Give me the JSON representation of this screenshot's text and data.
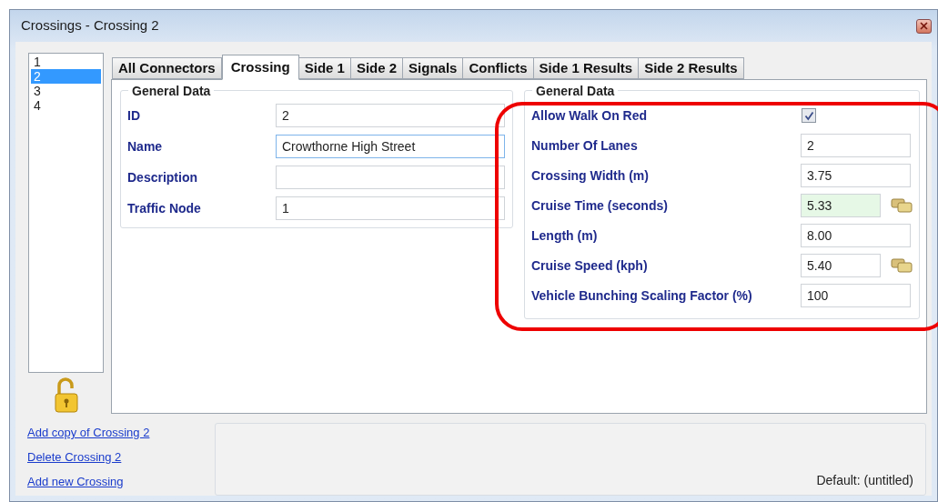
{
  "window": {
    "title": "Crossings - Crossing 2"
  },
  "list": [
    {
      "label": "1",
      "selected": false
    },
    {
      "label": "2",
      "selected": true
    },
    {
      "label": "3",
      "selected": false
    },
    {
      "label": "4",
      "selected": false
    }
  ],
  "tabs": [
    {
      "label": "All Connectors",
      "selected": false
    },
    {
      "label": "Crossing",
      "selected": true
    },
    {
      "label": "Side 1",
      "selected": false
    },
    {
      "label": "Side 2",
      "selected": false
    },
    {
      "label": "Signals",
      "selected": false
    },
    {
      "label": "Conflicts",
      "selected": false
    },
    {
      "label": "Side 1 Results",
      "selected": false
    },
    {
      "label": "Side 2 Results",
      "selected": false
    }
  ],
  "left_group": {
    "title": "General Data",
    "fields": [
      {
        "label": "ID",
        "value": "2",
        "focused": false
      },
      {
        "label": "Name",
        "value": "Crowthorne High Street",
        "focused": true
      },
      {
        "label": "Description",
        "focused": false
      },
      {
        "label": "Traffic Node",
        "value": "1",
        "focused": false
      }
    ]
  },
  "right_group": {
    "title": "General Data",
    "fields": [
      {
        "label": "Allow Walk On Red",
        "kind": "checkbox",
        "checked": true
      },
      {
        "label": "Number Of Lanes",
        "kind": "text",
        "value": "2",
        "tinted": false,
        "calc_button": false
      },
      {
        "label": "Crossing Width (m)",
        "kind": "text",
        "value": "3.75",
        "tinted": false,
        "calc_button": false
      },
      {
        "label": "Cruise Time (seconds)",
        "kind": "text",
        "value": "5.33",
        "tinted": true,
        "calc_button": true
      },
      {
        "label": "Length (m)",
        "kind": "text",
        "value": "8.00",
        "tinted": false,
        "calc_button": false
      },
      {
        "label": "Cruise Speed (kph)",
        "kind": "text",
        "value": "5.40",
        "tinted": false,
        "calc_button": true
      },
      {
        "label": "Vehicle Bunching Scaling Factor (%)",
        "kind": "text",
        "value": "100",
        "tinted": false,
        "calc_button": false
      }
    ]
  },
  "links": [
    "Add copy of Crossing 2",
    "Delete Crossing 2",
    "Add new Crossing"
  ],
  "status": "Default: (untitled)"
}
